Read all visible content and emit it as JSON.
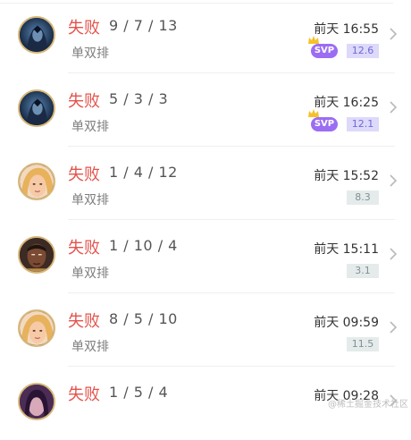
{
  "matches": [
    {
      "result": "失败",
      "kda": "9 / 7 / 13",
      "mode": "单双排",
      "time": "前天 16:55",
      "svp": true,
      "svp_label": "SVP",
      "score": "12.6",
      "hero": "dark-hooded-hero"
    },
    {
      "result": "失败",
      "kda": "5 / 3 / 3",
      "mode": "单双排",
      "time": "前天 16:25",
      "svp": true,
      "svp_label": "SVP",
      "score": "12.1",
      "hero": "dark-hooded-hero"
    },
    {
      "result": "失败",
      "kda": "1 / 4 / 12",
      "mode": "单双排",
      "time": "前天 15:52",
      "svp": false,
      "score": "8.3",
      "hero": "blonde-hero"
    },
    {
      "result": "失败",
      "kda": "1 / 10 / 4",
      "mode": "单双排",
      "time": "前天 15:11",
      "svp": false,
      "score": "3.1",
      "hero": "dark-skin-hero"
    },
    {
      "result": "失败",
      "kda": "8 / 5 / 10",
      "mode": "单双排",
      "time": "前天 09:59",
      "svp": false,
      "score": "11.5",
      "hero": "blonde-hero"
    },
    {
      "result": "失败",
      "kda": "1 / 5 / 4",
      "mode": "",
      "time": "前天 09:28",
      "svp": false,
      "score": "",
      "hero": "purple-hero"
    }
  ],
  "watermark": "@稀土掘金技术社区",
  "colors": {
    "loss": "#e4534c",
    "svp_badge": "#9b6df2",
    "svp_score_bg": "#dcd9fb",
    "plain_score_bg": "#e5ebeb",
    "avatar_border": "#d7b77a"
  }
}
